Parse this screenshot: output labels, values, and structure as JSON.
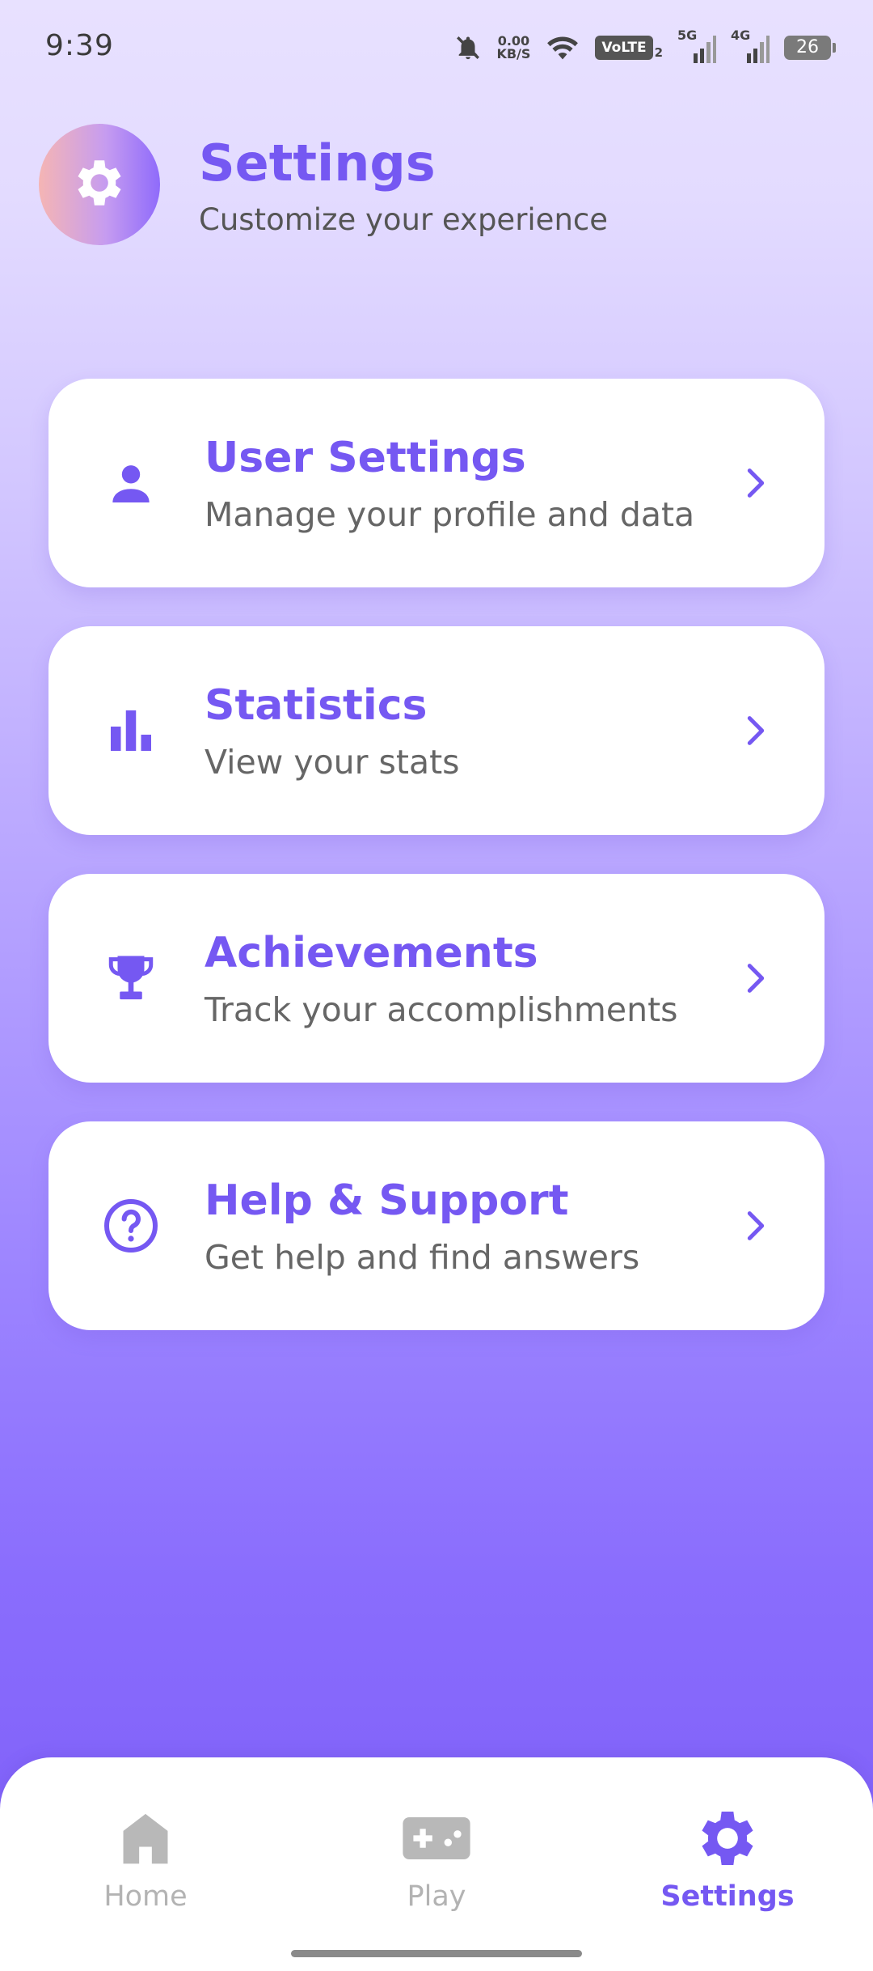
{
  "status_bar": {
    "time": "9:39",
    "net_speed_value": "0.00",
    "net_speed_unit": "KB/S",
    "volte": "VoLTE",
    "volte_sub": "2",
    "sig1_label": "5G",
    "sig2_label": "4G",
    "battery": "26"
  },
  "header": {
    "title": "Settings",
    "subtitle": "Customize your experience",
    "icon": "gear-icon"
  },
  "cards": [
    {
      "title": "User Settings",
      "subtitle": "Manage your profile and data",
      "icon": "person-icon"
    },
    {
      "title": "Statistics",
      "subtitle": "View your stats",
      "icon": "bar-chart-icon"
    },
    {
      "title": "Achievements",
      "subtitle": "Track your accomplishments",
      "icon": "trophy-icon"
    },
    {
      "title": "Help & Support",
      "subtitle": "Get help and find answers",
      "icon": "help-circle-icon"
    }
  ],
  "bottom_nav": {
    "items": [
      {
        "label": "Home",
        "icon": "home-icon",
        "active": false
      },
      {
        "label": "Play",
        "icon": "gamepad-icon",
        "active": false
      },
      {
        "label": "Settings",
        "icon": "gear-icon",
        "active": true
      }
    ]
  },
  "colors": {
    "accent": "#7558f2",
    "inactive": "#b3b3b3",
    "text_secondary": "#666666"
  }
}
